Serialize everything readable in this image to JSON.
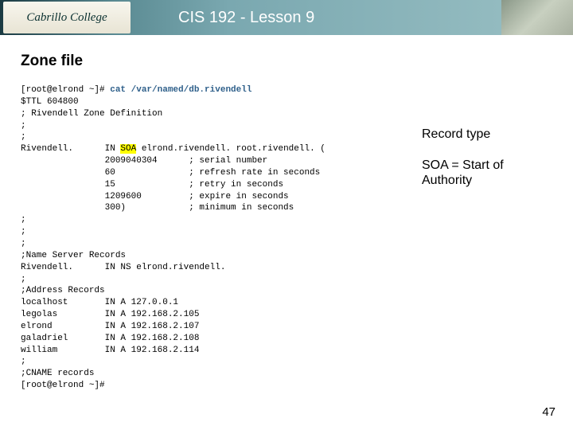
{
  "header": {
    "logo_text": "Cabrillo College",
    "title": "CIS 192 - Lesson 9"
  },
  "section_title": "Zone file",
  "code": {
    "prompt1": "[root@elrond ~]# ",
    "cmd": "cat /var/named/db.rivendell",
    "l2": "$TTL 604800",
    "l3": "; Rivendell Zone Definition",
    "l4": ";",
    "l5": ";",
    "l6a": "Rivendell.      IN ",
    "l6hl": "SOA",
    "l6b": " elrond.rivendell. root.rivendell. (",
    "l7": "                2009040304      ; serial number",
    "l8": "                60              ; refresh rate in seconds",
    "l9": "                15              ; retry in seconds",
    "l10": "                1209600         ; expire in seconds",
    "l11": "                300)            ; minimum in seconds",
    "l12": ";",
    "l13": ";",
    "l14": ";",
    "l15": ";Name Server Records",
    "l16": "Rivendell.      IN NS elrond.rivendell.",
    "l17": ";",
    "l18": ";Address Records",
    "l19": "localhost       IN A 127.0.0.1",
    "l20": "legolas         IN A 192.168.2.105",
    "l21": "elrond          IN A 192.168.2.107",
    "l22": "galadriel       IN A 192.168.2.108",
    "l23": "william         IN A 192.168.2.114",
    "l24": ";",
    "l25": ";CNAME records",
    "prompt2": "[root@elrond ~]#"
  },
  "annot": {
    "record_type": "Record type",
    "soa_line1": "SOA = Start of",
    "soa_line2": "Authority"
  },
  "page_number": "47"
}
